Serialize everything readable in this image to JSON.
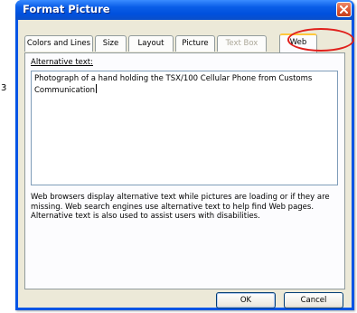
{
  "edge_glyph": "3",
  "window": {
    "title": "Format Picture",
    "accent_color": "#0055e5",
    "close_icon": "close-icon"
  },
  "tabs": [
    {
      "label": "Colors and Lines",
      "state": "normal"
    },
    {
      "label": "Size",
      "state": "normal"
    },
    {
      "label": "Layout",
      "state": "normal"
    },
    {
      "label": "Picture",
      "state": "normal"
    },
    {
      "label": "Text Box",
      "state": "disabled"
    },
    {
      "label": "Web",
      "state": "active"
    }
  ],
  "web_tab": {
    "alt_label": "Alternative text:",
    "alt_text_value": "Photograph of a hand holding the TSX/100 Cellular Phone from Customs Communication",
    "help_text": "Web browsers display alternative text while pictures are loading or if they are missing.  Web search engines use alternative text to help find Web pages.  Alternative text is also used to assist users with disabilities."
  },
  "buttons": {
    "ok": "OK",
    "cancel": "Cancel"
  },
  "annotation_color": "#e0201c"
}
